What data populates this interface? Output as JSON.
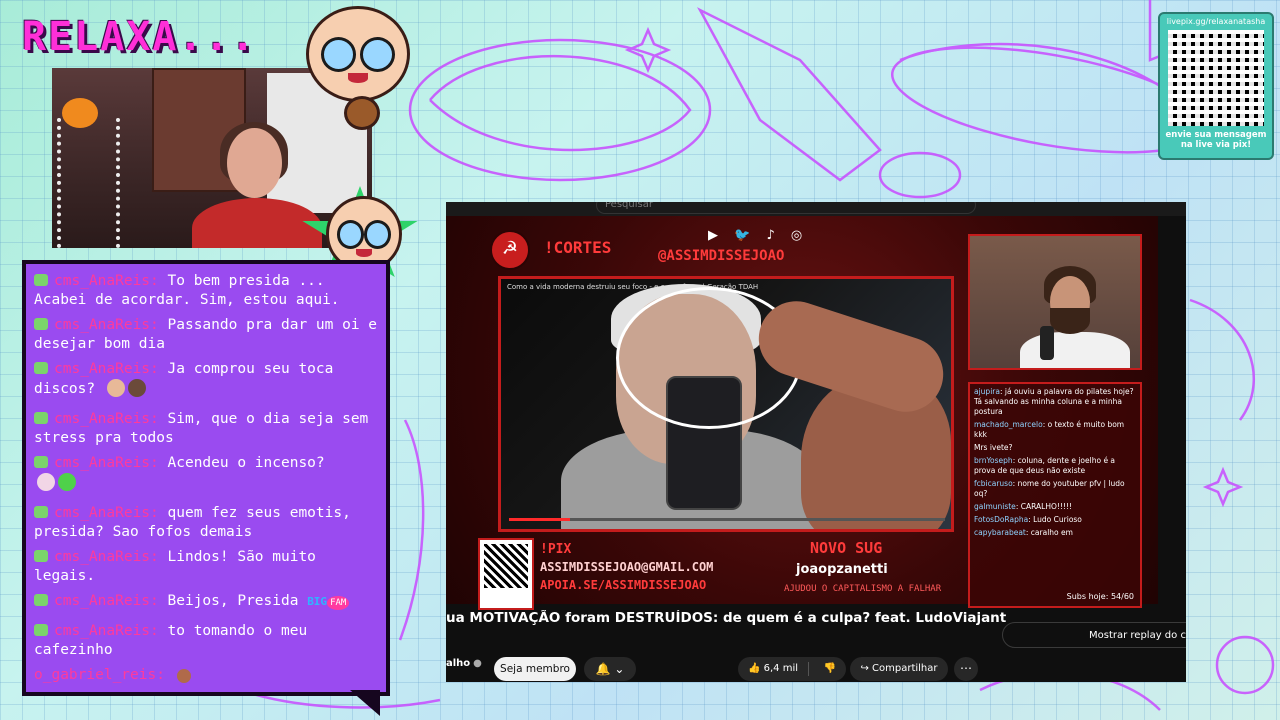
{
  "overlay": {
    "title": "RELAXA...",
    "qr_url": "livepix.gg/relaxanatasha",
    "qr_footer": "envie sua mensagem na live via pix!"
  },
  "chat": {
    "messages": [
      {
        "user": "cms_AnaReis:",
        "text": "To bem presida ... Acabei de acordar. Sim, estou aqui."
      },
      {
        "user": "cms_AnaReis:",
        "text": "Passando pra dar um oi e desejar bom dia"
      },
      {
        "user": "cms_AnaReis:",
        "text": "Ja comprou seu toca discos?"
      },
      {
        "user": "cms_AnaReis:",
        "text": "Sim, que o dia seja sem stress pra todos"
      },
      {
        "user": "cms_AnaReis:",
        "text": "Acendeu o incenso?"
      },
      {
        "user": "cms_AnaReis:",
        "text": "quem fez seus emotis, presida? Sao fofos demais"
      },
      {
        "user": "cms_AnaReis:",
        "text": "Lindos! São muito legais."
      },
      {
        "user": "cms_AnaReis:",
        "text": "Beijos, Presida"
      },
      {
        "user": "cms_AnaReis:",
        "text": "to tomando o meu cafezinho"
      },
      {
        "user": "o_gabriel_reis:",
        "text": ""
      }
    ],
    "badge_big": "BIG",
    "badge_fam": "FAM"
  },
  "stream": {
    "search_placeholder": "Pesquisar",
    "cortes_label": "!CORTES",
    "social_icons": "▶ 🐦 ♪ ◎",
    "handle": "@ASSIMDISSEJOAO",
    "inner_video_title": "Como a vida moderna destruiu seu foco - e o que fazer | Geração TDAH",
    "pix_label": "!PIX",
    "pix_email": "ASSIMDISSEJOAO@GMAIL.COM",
    "pix_apoia": "APOIA.SE/ASSIMDISSEJOAO",
    "novo_sug_label": "NOVO SUG",
    "novo_sug_value": "joaopzanetti",
    "novo_sug_credit": "AJUDOU O CAPITALISMO A FALHAR",
    "subs_today": "Subs hoje: 54/60",
    "progress_fraction": 0.14,
    "mini_chat": [
      {
        "user": "ajupira",
        "text": "já ouviu a palavra do pilates hoje? Tá salvando as minha coluna e a minha postura"
      },
      {
        "user": "machado_marcelo",
        "text": "o texto é muito bom kkk"
      },
      {
        "user": "",
        "text": "Mrs ivete?"
      },
      {
        "user": "",
        "text": ""
      },
      {
        "user": "brnYoseph",
        "text": "coluna, dente e joelho é a prova de que deus não existe"
      },
      {
        "user": "fcbicaruso",
        "text": "nome do youtuber pfv | ludo oq?"
      },
      {
        "user": "galmuniste",
        "text": "CARALHO!!!!!"
      },
      {
        "user": "FotosDoRapha",
        "text": "Ludo Curioso"
      },
      {
        "user": "capybarabeat",
        "text": "caralho em"
      }
    ]
  },
  "youtube": {
    "video_title": "ua MOTIVAÇÃO foram DESTRUÍDOS: de quem é a culpa? feat. LudoViajante | João",
    "replay_label": "Mostrar replay do chat",
    "channel_name": "alho",
    "member_label": "Seja membro",
    "bell_label": "🔔 ⌄",
    "like_count": "6,4 mil",
    "like_icon": "👍",
    "dislike_icon": "👎",
    "share_label": "↪ Compartilhar",
    "more_label": "⋯"
  }
}
